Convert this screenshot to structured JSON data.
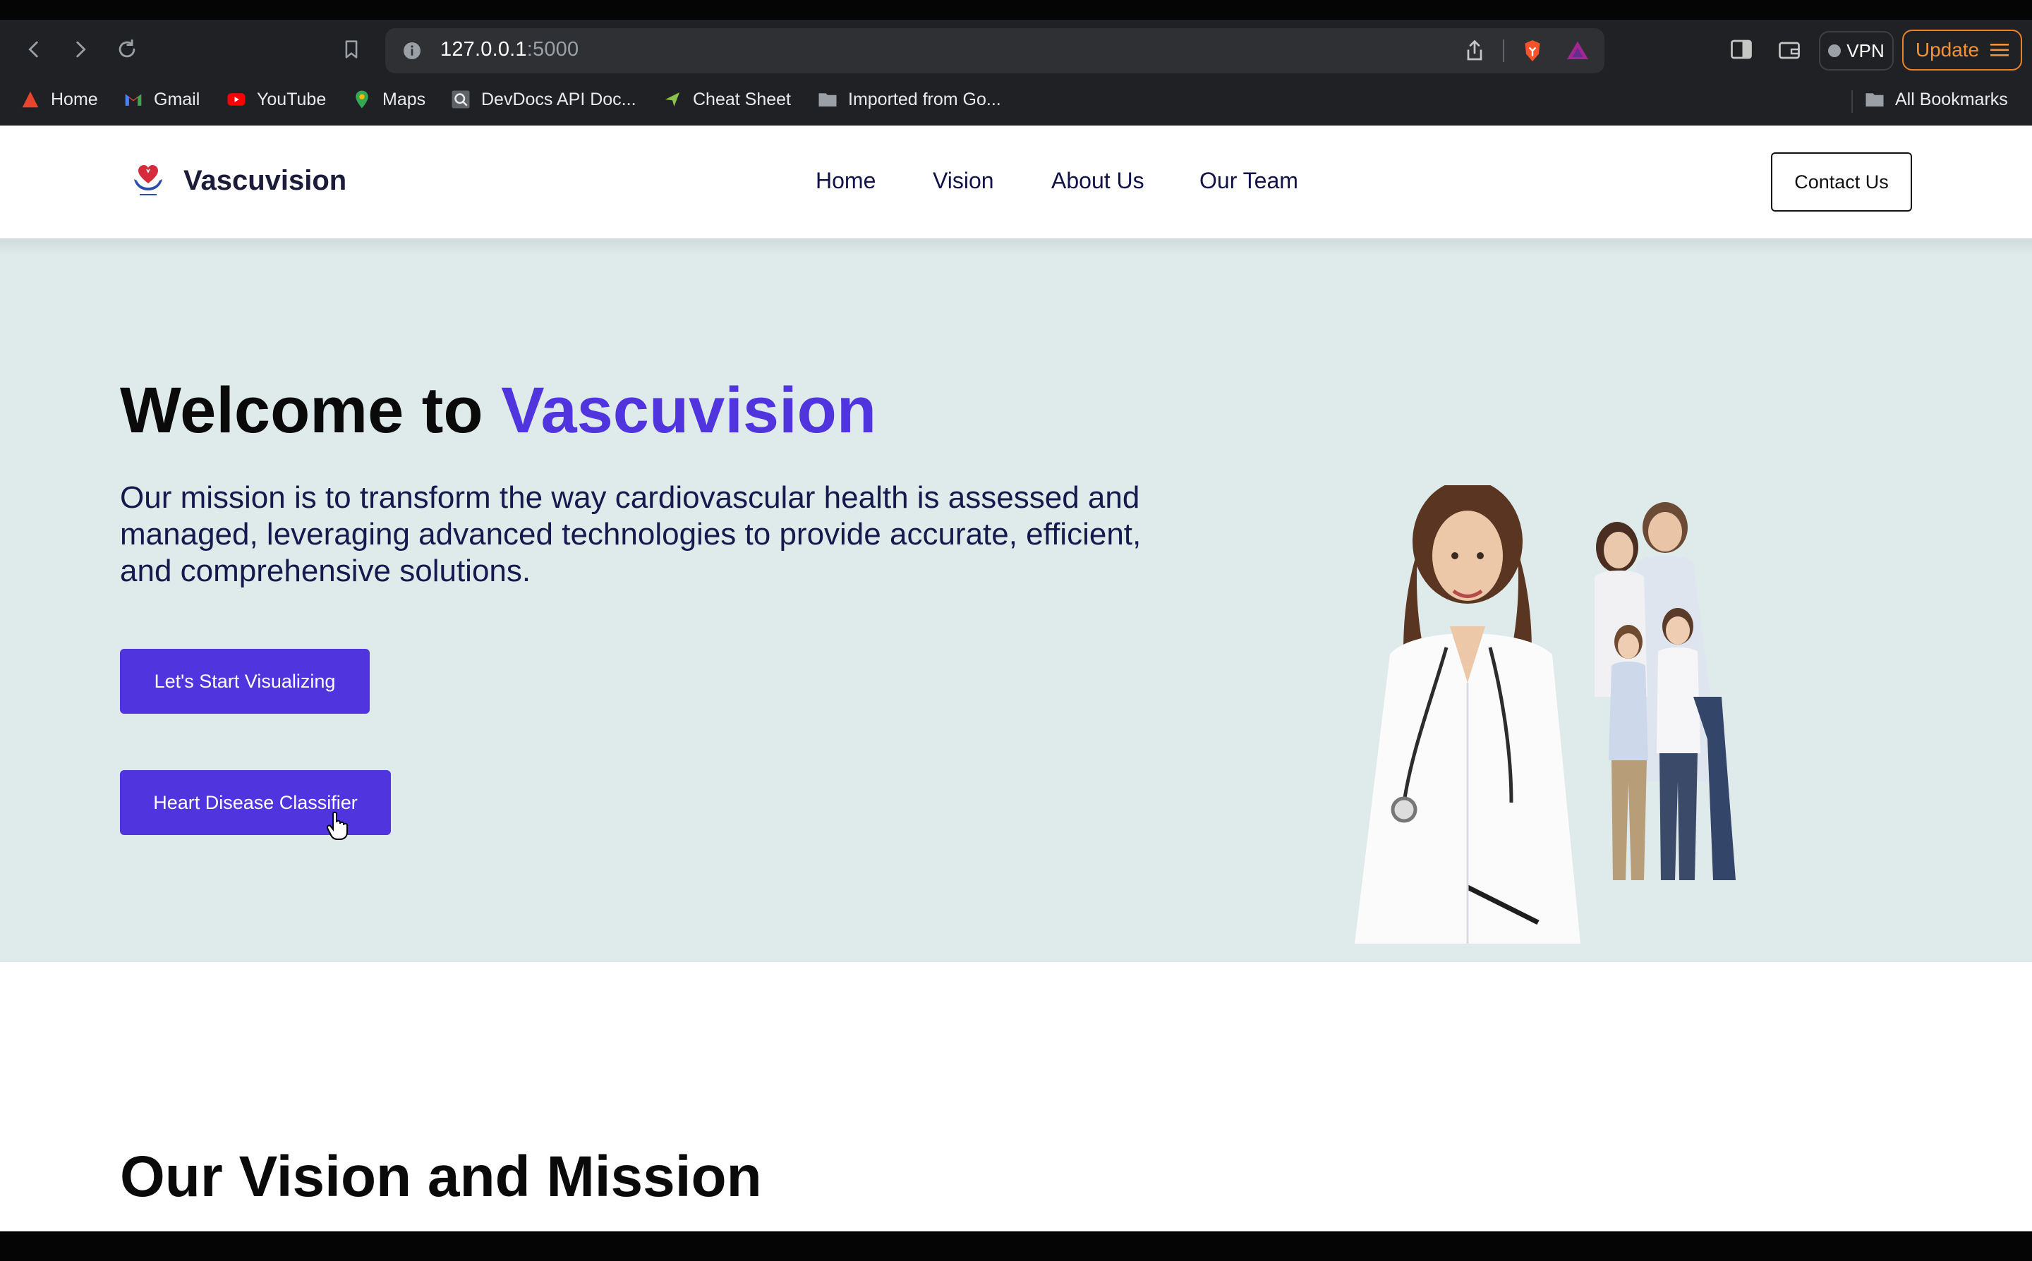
{
  "browser": {
    "url_host": "127.0.0.1",
    "url_port": ":5000",
    "vpn_label": "VPN",
    "update_label": "Update",
    "bookmarks": [
      {
        "label": "Home",
        "icon": "brave-icon",
        "color": "#e8452c"
      },
      {
        "label": "Gmail",
        "icon": "gmail-icon",
        "color": "#ea4335"
      },
      {
        "label": "YouTube",
        "icon": "youtube-icon",
        "color": "#ff0000"
      },
      {
        "label": "Maps",
        "icon": "maps-pin-icon",
        "color": "#34a853"
      },
      {
        "label": "DevDocs API Doc...",
        "icon": "devdocs-icon",
        "color": "#9aa0a6"
      },
      {
        "label": "Cheat Sheet",
        "icon": "cheatsheet-icon",
        "color": "#8bc34a"
      },
      {
        "label": "Imported from Go...",
        "icon": "folder-icon",
        "color": "#9aa0a6"
      }
    ],
    "all_bookmarks_label": "All Bookmarks"
  },
  "site": {
    "brand": "Vascuvision",
    "nav": [
      "Home",
      "Vision",
      "About Us",
      "Our Team"
    ],
    "contact_label": "Contact Us",
    "accent_color": "#5035de"
  },
  "hero": {
    "title_prefix": "Welcome to ",
    "title_accent": "Vascuvision",
    "description": "Our mission is to transform the way cardiovascular health is assessed and managed, leveraging advanced technologies to provide accurate, efficient, and comprehensive solutions.",
    "cta_primary": "Let's Start Visualizing",
    "cta_secondary": "Heart Disease Classifier"
  },
  "vision": {
    "title": "Our Vision and Mission"
  }
}
